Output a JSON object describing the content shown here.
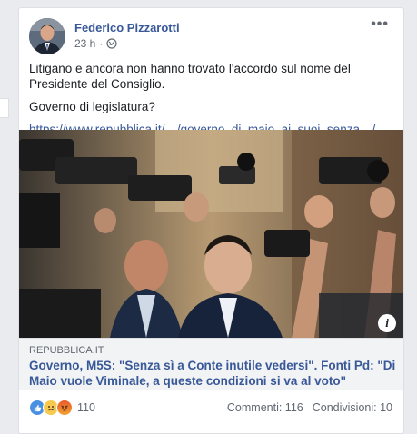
{
  "post": {
    "author": "Federico Pizzarotti",
    "time": "23 h",
    "separator": "·",
    "more_label": "•••",
    "text_line1": "Litigano e ancora non hanno trovato l'accordo sul nome del Presidente del Consiglio.",
    "text_line2": "Governo di legislatura?",
    "link_url": "https://www.repubblica.it/…/governo_di_maio_ai_suoi_senza…/…"
  },
  "link_preview": {
    "domain": "REPUBBLICA.IT",
    "headline": "Governo, M5S: \"Senza sì a Conte inutile vedersi\". Fonti Pd: \"Di Maio vuole Viminale, a queste condizioni si va al voto\"",
    "info_label": "i"
  },
  "footer": {
    "reactions": [
      "like-icon",
      "sad-icon",
      "angry-icon"
    ],
    "reaction_count": "110",
    "comments": "Commenti: 116",
    "shares": "Condivisioni: 10"
  },
  "colors": {
    "link": "#385898",
    "background": "#e9ebee",
    "card": "#ffffff",
    "preview_bg": "#f2f3f5"
  }
}
